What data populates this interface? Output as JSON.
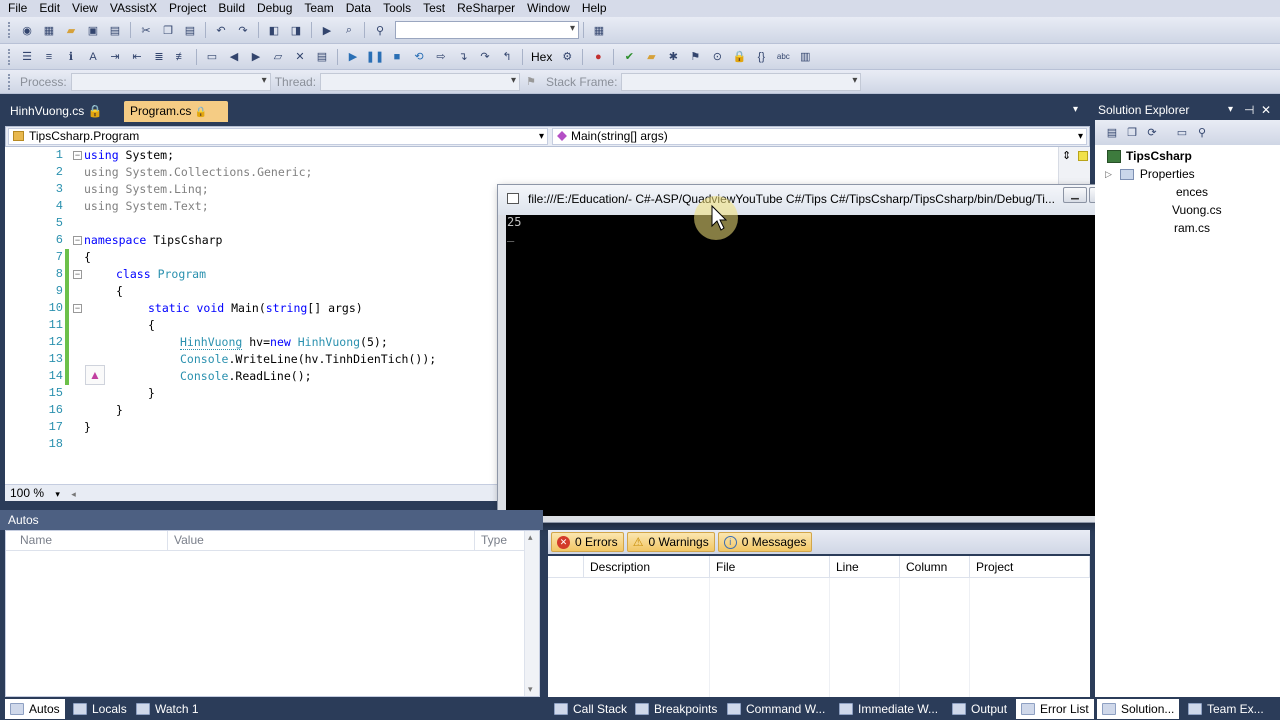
{
  "menu": [
    "File",
    "Edit",
    "View",
    "VAssistX",
    "Project",
    "Build",
    "Debug",
    "Team",
    "Data",
    "Tools",
    "Test",
    "ReSharper",
    "Window",
    "Help"
  ],
  "toolbar3": {
    "process_label": "Process:",
    "thread_label": "Thread:",
    "stack_frame_label": "Stack Frame:"
  },
  "toolbar2": {
    "hex_label": "Hex"
  },
  "doc_tabs": [
    "HinhVuong.cs",
    "Program.cs"
  ],
  "nav": {
    "left": "TipsCsharp.Program",
    "right": "Main(string[] args)"
  },
  "line_numbers": [
    "1",
    "2",
    "3",
    "4",
    "5",
    "6",
    "7",
    "8",
    "9",
    "10",
    "11",
    "12",
    "13",
    "14",
    "15",
    "16",
    "17",
    "18"
  ],
  "code": {
    "l1_kw": "using",
    "l1_rest": " System;",
    "l2": "using System.Collections.Generic;",
    "l3": "using System.Linq;",
    "l4": "using System.Text;",
    "l6_kw": "namespace",
    "l6_rest": " TipsCsharp",
    "l7": "{",
    "l8_kw": "class",
    "l8_ty": "Program",
    "l9": "{",
    "l10_kw1": "static",
    "l10_kw2": "void",
    "l10_name": "Main(",
    "l10_kw3": "string",
    "l10_rest": "[] args)",
    "l11": "{",
    "l12_ty": "HinhVuong",
    "l12_mid": " hv=",
    "l12_kw": "new",
    "l12_ty2": "HinhVuong",
    "l12_end": "(5);",
    "l13_ty": "Console",
    "l13_rest": ".WriteLine(hv.TinhDienTich());",
    "l14_ty": "Console",
    "l14_rest": ".ReadLine();",
    "l15": "}",
    "l16": "}",
    "l17": "}"
  },
  "zoom": "100 %",
  "console": {
    "title": "file:///E:/Education/- C#-ASP/QuadviewYouTube C#/Tips C#/TipsCsharp/TipsCsharp/bin/Debug/Ti...",
    "output": "25",
    "cursor": "_"
  },
  "solution": {
    "header": "Solution Explorer",
    "project": "TipsCsharp",
    "items": [
      "Properties",
      "ences",
      "Vuong.cs",
      "ram.cs"
    ]
  },
  "autos": {
    "title": "Autos",
    "cols": [
      "Name",
      "Value",
      "Type"
    ]
  },
  "errors": {
    "errors": "0 Errors",
    "warnings": "0 Warnings",
    "messages": "0 Messages",
    "cols": [
      "Description",
      "File",
      "Line",
      "Column",
      "Project"
    ]
  },
  "bottom_tabs_left": [
    "Autos",
    "Locals",
    "Watch 1"
  ],
  "bottom_tabs_mid": [
    "Call Stack",
    "Breakpoints",
    "Command W...",
    "Immediate W...",
    "Output",
    "Error List"
  ],
  "bottom_tabs_right": [
    "Solution...",
    "Team Ex..."
  ]
}
